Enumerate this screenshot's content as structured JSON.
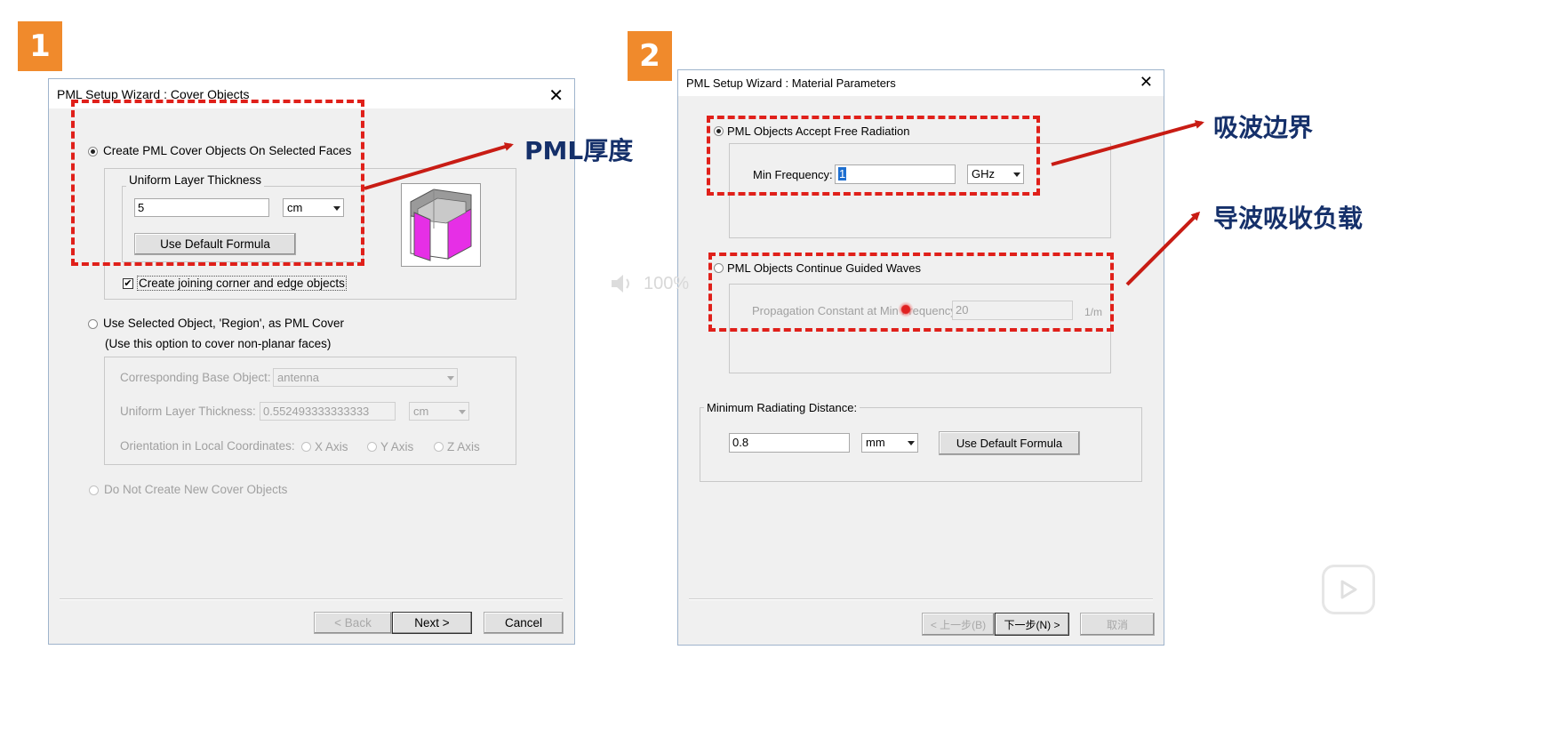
{
  "badges": [
    "1",
    "2"
  ],
  "dialog1": {
    "title": "PML Setup Wizard : Cover Objects",
    "close": "✕",
    "opt_create": "Create PML Cover Objects On Selected Faces",
    "group_uniform": "Uniform Layer Thickness",
    "thickness_value": "5",
    "thickness_unit": "cm",
    "use_default_formula": "Use Default Formula",
    "joining_checkbox": "Create joining corner and edge objects",
    "opt_use_selected": "Use Selected Object, 'Region', as PML Cover",
    "opt_use_selected_hint": "(Use this option to cover non-planar faces)",
    "corresponding_base_label": "Corresponding Base Object:",
    "corresponding_base_value": "antenna",
    "uniform_thickness_label": "Uniform Layer Thickness:",
    "uniform_thickness_value": "0.552493333333333",
    "uniform_thickness_unit": "cm",
    "orientation_label": "Orientation in Local Coordinates:",
    "x_axis": "X Axis",
    "y_axis": "Y Axis",
    "z_axis": "Z Axis",
    "opt_do_not_create": "Do Not Create New Cover Objects",
    "back": "< Back",
    "next": "Next >",
    "cancel": "Cancel"
  },
  "dialog2": {
    "title": "PML Setup Wizard : Material Parameters",
    "close": "✕",
    "opt_free_radiation": "PML Objects Accept Free Radiation",
    "min_frequency_label": "Min Frequency:",
    "min_frequency_value": "1",
    "min_frequency_unit": "GHz",
    "opt_guided_waves": "PML Objects Continue Guided Waves",
    "propagation_label": "Propagation Constant at Min Frequency:",
    "propagation_value": "20",
    "propagation_unit": "1/m",
    "min_radiating_label": "Minimum Radiating Distance:",
    "min_radiating_value": "0.8",
    "min_radiating_unit": "mm",
    "use_default_formula": "Use Default Formula",
    "back": "< 上一步(B)",
    "next": "下一步(N) >",
    "cancel": "取消"
  },
  "annotations": {
    "pml_thickness": "PML厚度",
    "absorbing_boundary": "吸波边界",
    "waveguide_load": "导波吸收负载"
  },
  "overlay": {
    "volume_text": "100%"
  },
  "colors": {
    "annotation_red": "#e0201a",
    "annotation_text": "#15306a",
    "badge": "#f08a2c",
    "cube_magenta": "#e62fe6"
  }
}
